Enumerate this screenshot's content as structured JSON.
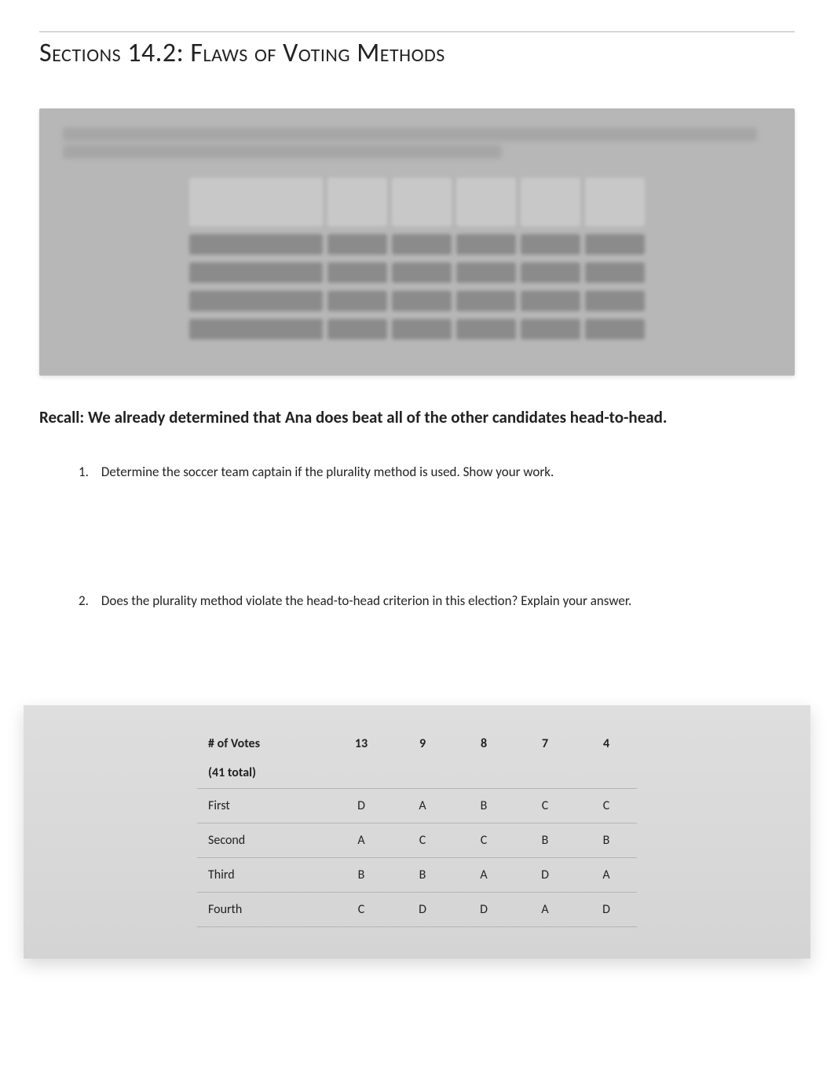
{
  "title": "Sections 14.2: Flaws of Voting Methods",
  "recall": "Recall: We already determined that Ana does beat all of the other candidates head-to-head.",
  "questions": [
    {
      "num": "1.",
      "text": "Determine the soccer team captain if the plurality method is used. Show your work."
    },
    {
      "num": "2.",
      "text": "Does the plurality method violate the head-to-head criterion in this election? Explain your answer."
    }
  ],
  "pref_table": {
    "header_label_line1": "# of Votes",
    "header_label_line2": "(41 total)",
    "votes": [
      "13",
      "9",
      "8",
      "7",
      "4"
    ],
    "rows": [
      {
        "label": "First",
        "vals": [
          "D",
          "A",
          "B",
          "C",
          "C"
        ]
      },
      {
        "label": "Second",
        "vals": [
          "A",
          "C",
          "C",
          "B",
          "B"
        ]
      },
      {
        "label": "Third",
        "vals": [
          "B",
          "B",
          "A",
          "D",
          "A"
        ]
      },
      {
        "label": "Fourth",
        "vals": [
          "C",
          "D",
          "D",
          "A",
          "D"
        ]
      }
    ]
  },
  "chart_data": {
    "type": "table",
    "title": "Preference Schedule (41 total votes)",
    "columns": [
      "# of Votes",
      "13",
      "9",
      "8",
      "7",
      "4"
    ],
    "rows": [
      [
        "First",
        "D",
        "A",
        "B",
        "C",
        "C"
      ],
      [
        "Second",
        "A",
        "C",
        "C",
        "B",
        "B"
      ],
      [
        "Third",
        "B",
        "B",
        "A",
        "D",
        "A"
      ],
      [
        "Fourth",
        "C",
        "D",
        "D",
        "A",
        "D"
      ]
    ]
  }
}
